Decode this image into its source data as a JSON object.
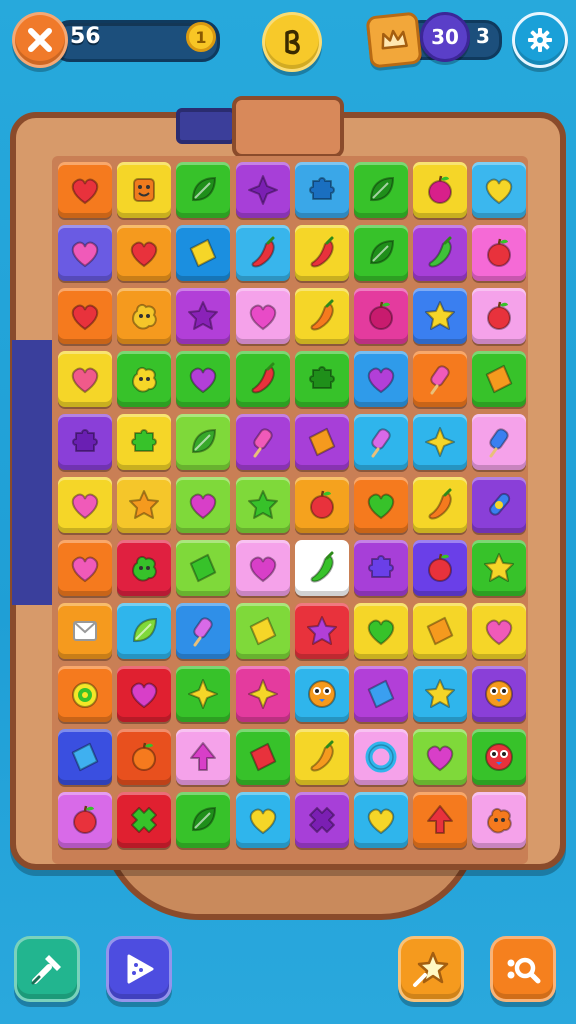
{
  "hud": {
    "score": "56",
    "coin_count": "1",
    "moves": "30",
    "moves_extra": "3",
    "icons": {
      "close": "close-x-icon",
      "center": "boost-icon",
      "crown": "crown-icon",
      "settings": "gear-icon"
    }
  },
  "board": {
    "cols": 8,
    "rows": 11,
    "tiles": [
      [
        {
          "bg": "#f57a1e",
          "shape": "heart",
          "c": "#e8323c"
        },
        {
          "bg": "#f5d628",
          "shape": "face",
          "c": "#ef7b1e"
        },
        {
          "bg": "#37c22a",
          "shape": "leaf",
          "c": "#1f8f1a"
        },
        {
          "bg": "#a73fd8",
          "shape": "star4",
          "c": "#7b1fb3"
        },
        {
          "bg": "#3aa7e8",
          "shape": "puzzle",
          "c": "#1a6fc0"
        },
        {
          "bg": "#37c22a",
          "shape": "leaf",
          "c": "#1f8f1a"
        },
        {
          "bg": "#f5d628",
          "shape": "apple",
          "c": "#d8208a"
        },
        {
          "bg": "#3bb7ee",
          "shape": "heart",
          "c": "#f5d628"
        }
      ],
      [
        {
          "bg": "#6a5be3",
          "shape": "heart",
          "c": "#f05ab9"
        },
        {
          "bg": "#f59a1e",
          "shape": "heart",
          "c": "#e8323c"
        },
        {
          "bg": "#1b8fe0",
          "shape": "diamond",
          "c": "#f5d628"
        },
        {
          "bg": "#38b5ec",
          "shape": "chili",
          "c": "#e8323c"
        },
        {
          "bg": "#f5d628",
          "shape": "chili",
          "c": "#e8323c"
        },
        {
          "bg": "#37c22a",
          "shape": "leaf",
          "c": "#1f8f1a"
        },
        {
          "bg": "#a73fd8",
          "shape": "chili",
          "c": "#3fc23a"
        },
        {
          "bg": "#f56ad6",
          "shape": "apple",
          "c": "#e8323c"
        }
      ],
      [
        {
          "bg": "#f57a1e",
          "shape": "heart",
          "c": "#e8323c"
        },
        {
          "bg": "#f59a1e",
          "shape": "blob",
          "c": "#f5c62a"
        },
        {
          "bg": "#b23fd8",
          "shape": "star5",
          "c": "#8a22b8"
        },
        {
          "bg": "#f5a2ea",
          "shape": "heart",
          "c": "#e84bc7"
        },
        {
          "bg": "#f5d628",
          "shape": "chili",
          "c": "#f57a1e"
        },
        {
          "bg": "#e43b9e",
          "shape": "apple",
          "c": "#c81b6e"
        },
        {
          "bg": "#3a7ff0",
          "shape": "star5",
          "c": "#f5d628"
        },
        {
          "bg": "#f5a2ea",
          "shape": "apple",
          "c": "#e8323c"
        }
      ],
      [
        {
          "bg": "#f5d628",
          "shape": "heart",
          "c": "#f05a8a"
        },
        {
          "bg": "#37c22a",
          "shape": "blob",
          "c": "#f5d628"
        },
        {
          "bg": "#37c22a",
          "shape": "heart",
          "c": "#b23fd8"
        },
        {
          "bg": "#37c22a",
          "shape": "chili",
          "c": "#e8323c"
        },
        {
          "bg": "#37c22a",
          "shape": "puzzle",
          "c": "#1f8f1a"
        },
        {
          "bg": "#2f9bea",
          "shape": "heart",
          "c": "#b23fd8"
        },
        {
          "bg": "#f57a1e",
          "shape": "pop",
          "c": "#f05ab9"
        },
        {
          "bg": "#37c22a",
          "shape": "diamond",
          "c": "#f59a1e"
        }
      ],
      [
        {
          "bg": "#8a3fd8",
          "shape": "puzzle",
          "c": "#6a1fb3"
        },
        {
          "bg": "#f5d628",
          "shape": "puzzle",
          "c": "#37c22a"
        },
        {
          "bg": "#7fd93a",
          "shape": "leaf",
          "c": "#37a82a"
        },
        {
          "bg": "#a73fd8",
          "shape": "pop",
          "c": "#f05ab9"
        },
        {
          "bg": "#a73fd8",
          "shape": "diamond",
          "c": "#f59a1e"
        },
        {
          "bg": "#2fb5ec",
          "shape": "pop",
          "c": "#d86ae8"
        },
        {
          "bg": "#2fb5ec",
          "shape": "star4",
          "c": "#f5d628"
        },
        {
          "bg": "#f5a2ea",
          "shape": "pop",
          "c": "#3a7ff0"
        }
      ],
      [
        {
          "bg": "#f5d628",
          "shape": "heart",
          "c": "#f05ab9"
        },
        {
          "bg": "#f5c62a",
          "shape": "star5",
          "c": "#f59a1e"
        },
        {
          "bg": "#7fd93a",
          "shape": "heart",
          "c": "#d83fc8"
        },
        {
          "bg": "#7fd93a",
          "shape": "star5",
          "c": "#37c22a"
        },
        {
          "bg": "#f5a21e",
          "shape": "apple",
          "c": "#e8323c"
        },
        {
          "bg": "#f57a1e",
          "shape": "heart",
          "c": "#37c22a"
        },
        {
          "bg": "#f5d628",
          "shape": "chili",
          "c": "#f57a1e"
        },
        {
          "bg": "#8a3fd8",
          "shape": "pin",
          "c": "#3a7ff0"
        }
      ],
      [
        {
          "bg": "#f57a1e",
          "shape": "heart",
          "c": "#f05ab9"
        },
        {
          "bg": "#e02040",
          "shape": "blob",
          "c": "#37c22a"
        },
        {
          "bg": "#7fd93a",
          "shape": "diamond",
          "c": "#37c22a"
        },
        {
          "bg": "#f5a2ea",
          "shape": "heart",
          "c": "#d83fc8"
        },
        {
          "bg": "#ffffff",
          "shape": "chili",
          "c": "#37c22a"
        },
        {
          "bg": "#a73fd8",
          "shape": "puzzle",
          "c": "#6a3fe8"
        },
        {
          "bg": "#6a3fe8",
          "shape": "apple",
          "c": "#e8323c"
        },
        {
          "bg": "#37c22a",
          "shape": "star5",
          "c": "#f5d628"
        }
      ],
      [
        {
          "bg": "#f59a1e",
          "shape": "card",
          "c": "#ffffff"
        },
        {
          "bg": "#2fb5ec",
          "shape": "leaf",
          "c": "#7fd93a"
        },
        {
          "bg": "#2f8fe8",
          "shape": "pop",
          "c": "#d86ae8"
        },
        {
          "bg": "#7fd93a",
          "shape": "diamond",
          "c": "#f5d628"
        },
        {
          "bg": "#e8323c",
          "shape": "star5",
          "c": "#b23fd8"
        },
        {
          "bg": "#f5d628",
          "shape": "heart",
          "c": "#37c22a"
        },
        {
          "bg": "#f5d628",
          "shape": "diamond",
          "c": "#f59a1e"
        },
        {
          "bg": "#f5d628",
          "shape": "heart",
          "c": "#f05ab9"
        }
      ],
      [
        {
          "bg": "#f57a1e",
          "shape": "lime",
          "c": "#37c22a"
        },
        {
          "bg": "#e02030",
          "shape": "heart",
          "c": "#d83fc8"
        },
        {
          "bg": "#37c22a",
          "shape": "star4",
          "c": "#f5d628"
        },
        {
          "bg": "#e43b9e",
          "shape": "star4",
          "c": "#f5d628"
        },
        {
          "bg": "#2fb5ec",
          "shape": "owl",
          "c": "#f59a1e"
        },
        {
          "bg": "#b23fd8",
          "shape": "diamond",
          "c": "#3a9ff0"
        },
        {
          "bg": "#2fb5ec",
          "shape": "star5",
          "c": "#f5d628"
        },
        {
          "bg": "#8a3fd8",
          "shape": "owl",
          "c": "#f59a1e"
        }
      ],
      [
        {
          "bg": "#3a4fe0",
          "shape": "diamond",
          "c": "#3fb0f0"
        },
        {
          "bg": "#e8501e",
          "shape": "apple",
          "c": "#f57a1e"
        },
        {
          "bg": "#f5a2ea",
          "shape": "tree",
          "c": "#d83fc8"
        },
        {
          "bg": "#37c22a",
          "shape": "diamond",
          "c": "#e8323c"
        },
        {
          "bg": "#f5d628",
          "shape": "chili",
          "c": "#f59a1e"
        },
        {
          "bg": "#f5a2ea",
          "shape": "ring",
          "c": "#2fb5ec"
        },
        {
          "bg": "#7fd93a",
          "shape": "heart",
          "c": "#d83fc8"
        },
        {
          "bg": "#37c22a",
          "shape": "owl",
          "c": "#e8323c"
        }
      ],
      [
        {
          "bg": "#d86ae8",
          "shape": "apple",
          "c": "#e8323c"
        },
        {
          "bg": "#e02030",
          "shape": "cross",
          "c": "#37c22a"
        },
        {
          "bg": "#37c22a",
          "shape": "leaf",
          "c": "#1f8f1a"
        },
        {
          "bg": "#2fb5ec",
          "shape": "heart",
          "c": "#f5d628"
        },
        {
          "bg": "#a73fd8",
          "shape": "cross",
          "c": "#7b1fb3"
        },
        {
          "bg": "#2fb5ec",
          "shape": "heart",
          "c": "#f5d628"
        },
        {
          "bg": "#f57a1e",
          "shape": "tree",
          "c": "#e8323c"
        },
        {
          "bg": "#f5a2ea",
          "shape": "blob",
          "c": "#f57a1e"
        }
      ]
    ]
  },
  "bottom": {
    "buttons": [
      {
        "name": "hammer-boost-button",
        "icon": "hammer-icon",
        "color": "#22b58f"
      },
      {
        "name": "shuffle-boost-button",
        "icon": "play-triangle-icon",
        "color": "#4d4de0"
      },
      {
        "name": "star-boost-button",
        "icon": "star-wand-icon",
        "color": "#f59a1e"
      },
      {
        "name": "search-boost-button",
        "icon": "magnifier-icon",
        "color": "#f5801e"
      }
    ]
  }
}
